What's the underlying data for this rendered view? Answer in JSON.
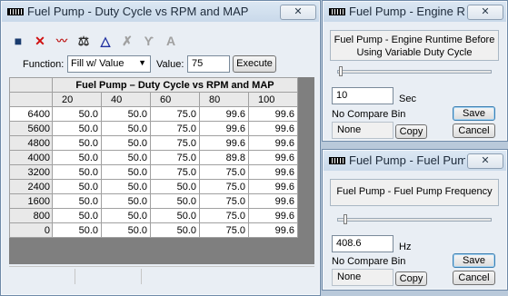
{
  "main_window": {
    "title": "Fuel Pump - Duty Cycle vs RPM and MAP",
    "close": "✕",
    "function_label": "Function:",
    "function_value": "Fill w/ Value",
    "value_label": "Value:",
    "value": "75",
    "execute_label": "Execute",
    "toolbar": [
      "save-icon",
      "delete-icon",
      "graph-icon",
      "balance-icon",
      "triangle-icon",
      "scale-x-icon",
      "interpolate-icon",
      "text-a-icon"
    ],
    "table": {
      "title": "Fuel Pump – Duty Cycle vs RPM and MAP",
      "columns": [
        "20",
        "40",
        "60",
        "80",
        "100"
      ],
      "rows": [
        {
          "rpm": "6400",
          "values": [
            "50.0",
            "50.0",
            "75.0",
            "99.6",
            "99.6"
          ]
        },
        {
          "rpm": "5600",
          "values": [
            "50.0",
            "50.0",
            "75.0",
            "99.6",
            "99.6"
          ]
        },
        {
          "rpm": "4800",
          "values": [
            "50.0",
            "50.0",
            "75.0",
            "99.6",
            "99.6"
          ]
        },
        {
          "rpm": "4000",
          "values": [
            "50.0",
            "50.0",
            "75.0",
            "89.8",
            "99.6"
          ]
        },
        {
          "rpm": "3200",
          "values": [
            "50.0",
            "50.0",
            "75.0",
            "75.0",
            "99.6"
          ]
        },
        {
          "rpm": "2400",
          "values": [
            "50.0",
            "50.0",
            "50.0",
            "75.0",
            "99.6"
          ]
        },
        {
          "rpm": "1600",
          "values": [
            "50.0",
            "50.0",
            "50.0",
            "75.0",
            "99.6"
          ]
        },
        {
          "rpm": "800",
          "values": [
            "50.0",
            "50.0",
            "50.0",
            "75.0",
            "99.6"
          ]
        },
        {
          "rpm": "0",
          "values": [
            "50.0",
            "50.0",
            "50.0",
            "75.0",
            "99.6"
          ]
        }
      ]
    }
  },
  "runtime_window": {
    "title": "Fuel Pump - Engine Runti",
    "close": "✕",
    "description_line1": "Fuel Pump - Engine Runtime Before",
    "description_line2": "Using Variable Duty Cycle",
    "value": "10",
    "unit": "Sec",
    "compare": "No Compare Bin",
    "save_label": "Save",
    "none_value": "None",
    "copy_label": "Copy",
    "cancel_label": "Cancel"
  },
  "frequency_window": {
    "title": "Fuel Pump - Fuel Pump ...",
    "close": "✕",
    "description": "Fuel Pump - Fuel Pump Frequency",
    "value": "408.6",
    "unit": "Hz",
    "compare": "No Compare Bin",
    "save_label": "Save",
    "none_value": "None",
    "copy_label": "Copy",
    "cancel_label": "Cancel"
  }
}
